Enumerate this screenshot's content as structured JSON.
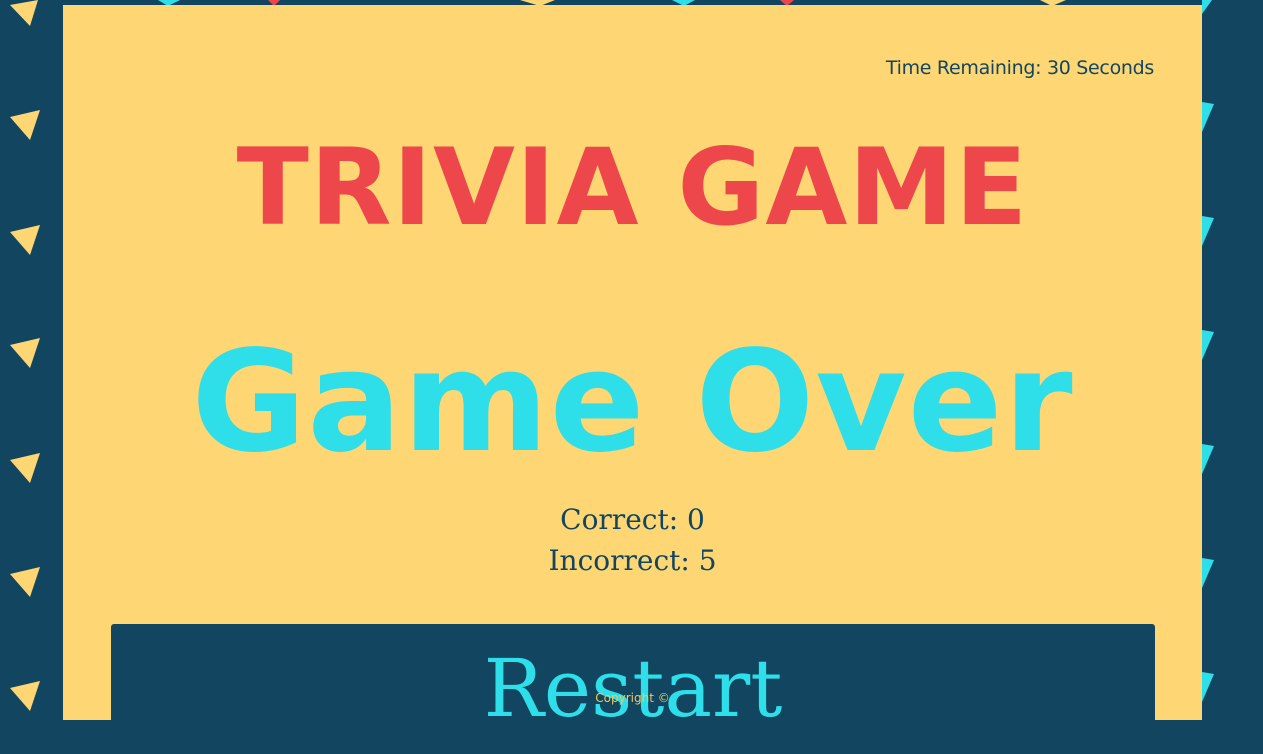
{
  "header": {
    "timer_text": "Time Remaining: 30 Seconds"
  },
  "main": {
    "title": "TRIVIA GAME",
    "status": "Game Over",
    "correct_text": "Correct: 0",
    "incorrect_text": "Incorrect: 5",
    "restart_label": "Restart"
  },
  "footer": {
    "copyright": "Copyright ©"
  },
  "colors": {
    "background": "#124660",
    "panel": "#fed674",
    "title": "#ed474c",
    "status": "#2edee8",
    "text": "#124660",
    "decor_left": "#fed674",
    "decor_right": "#2edee8"
  }
}
